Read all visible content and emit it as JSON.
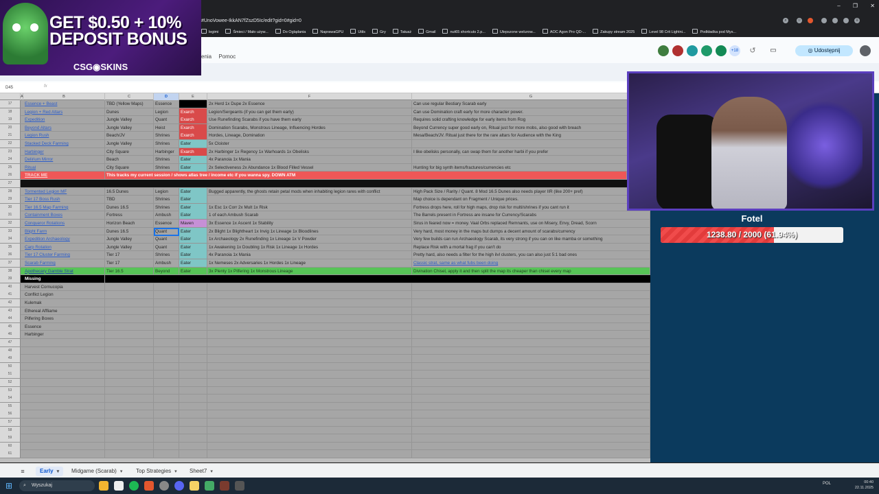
{
  "browser": {
    "url": "#UnoVowee-IkkAN7fZszD5Ic/edit?gid=0#gid=0",
    "bookmarks": [
      "legimi",
      "Śmieci / Mało używ...",
      "Do Oglądania",
      "NaprawaGPU",
      "Utils",
      "Gry",
      "Tatuaż",
      "Gmail",
      "nut65 shortcuts 2.p...",
      "Ulepszone welurow...",
      "AOC Agon Pro QD-...",
      "Zakupy stream 2025",
      "Level 98 Crit Lightni...",
      "Podkładka pod Mys..."
    ]
  },
  "sheets": {
    "menu": [
      "enia",
      "Pomoc"
    ],
    "extensions_count": "+18",
    "share_label": "Udostępnij",
    "namebox": "D45"
  },
  "ad": {
    "line1": "GET $0.50 + 10%",
    "line2": "DEPOSIT BONUS",
    "brand": "CSG◉SKINS"
  },
  "columns": [
    "A",
    "B",
    "C",
    "D",
    "E",
    "F",
    "G"
  ],
  "selected_column": "D",
  "rows": [
    {
      "n": "17",
      "b": "Essence + Beast",
      "c": "TBD (Yellow Maps)",
      "d": "Essence",
      "e": "",
      "ecls": "blackcell",
      "f": "2x Herd 1x Dupe 2x Essence",
      "g": "Can use regular Bestiary Scarab early"
    },
    {
      "n": "18",
      "b": "Legion + Red Altars",
      "c": "Dunes",
      "d": "Legion",
      "e": "Exarch",
      "ecls": "exarch",
      "f": "Legion/Sergeants (if you can get them early)",
      "g": "Can use Domination craft early for more character power."
    },
    {
      "n": "19",
      "b": "Expedition",
      "c": "Jungle Valley",
      "d": "Quant",
      "e": "Exarch",
      "ecls": "exarch",
      "f": "Use Runefinding Scarabs if you have them early",
      "g": "Requires solid crafting knowledge for early items from Rog"
    },
    {
      "n": "20",
      "b": "Beyond Altars",
      "c": "Jungle Valley",
      "d": "Heist",
      "e": "Exarch",
      "ecls": "exarch",
      "f": "Domination Scarabs, Monstrous Lineage, Influencing Hordes",
      "g": "Beyond Currency super good early on, Ritual just for more mobs, also good with breach"
    },
    {
      "n": "21",
      "b": "Legion Rush",
      "c": "Beach/JV",
      "d": "Shrines",
      "e": "Exarch",
      "ecls": "exarch",
      "f": "Hordes, Lineage, Domination",
      "g": "Mesa/Beach/JV. Ritual just there for the rare altars for Audience with the King"
    },
    {
      "n": "22",
      "b": "Stacked Deck Farming",
      "c": "Jungle Valley",
      "d": "Shrines",
      "e": "Eater",
      "ecls": "eater",
      "f": "5x Cloister",
      "g": ""
    },
    {
      "n": "23",
      "b": "Harbinger",
      "c": "City Square",
      "d": "Harbinger",
      "e": "Exarch",
      "ecls": "exarch",
      "f": "2x Harbinger 1x Regency 1x Warhoards 1x Obelisks",
      "g": "I like obelisks personally, can swap them for another harbi if you prefer"
    },
    {
      "n": "24",
      "b": "Delirium Mirror",
      "c": "Beach",
      "d": "Shrines",
      "e": "Eater",
      "ecls": "eater",
      "f": "4x Paranoia 1x Mania",
      "g": ""
    },
    {
      "n": "25",
      "b": "Ritual",
      "c": "City Square",
      "d": "Shrines",
      "e": "Eater",
      "ecls": "eater",
      "f": "2x Selectiveness 2x Abundance 1x Blood Filled Vessel",
      "g": "Hunting for big synth items/fractures/currencies etc"
    },
    {
      "n": "26",
      "type": "red",
      "b": "TRACK ME",
      "c": "This tracks my current session / shows atlas tree / income etc if you wanna spy. DOWN ATM"
    },
    {
      "n": "27",
      "type": "blank"
    },
    {
      "n": "28",
      "b": "Tormented Legion MF",
      "c": "16.5 Dunes",
      "d": "Legion",
      "e": "Eater",
      "ecls": "eater",
      "f": "Bugged apparently, the ghosts retain petal mods when inhabiting legion rares with conflict",
      "g": "High Pack Size / Rarity / Quant. 8 Mod 16.5 Dunes also needs player IIR (like 200+ pref)"
    },
    {
      "n": "29",
      "b": "Tier 17 Boss Rush",
      "c": "TBD",
      "d": "Shrines",
      "e": "Eater",
      "ecls": "eater",
      "f": "",
      "g": "Map choice is dependant on Fragment / Unique prices."
    },
    {
      "n": "30",
      "b": "Tier 16.5 Map Farming",
      "c": "Dunes 16.5",
      "d": "Shrines",
      "e": "Eater",
      "ecls": "eater",
      "f": "1x Esc 1x Corr 2x Mult 1x Risk",
      "g": "Fortress drops here, roll for high maps, drop risk for multi/shrines if you cant run it"
    },
    {
      "n": "31",
      "b": "Containment Boxes",
      "c": "Fortress",
      "d": "Ambush",
      "e": "Eater",
      "ecls": "eater",
      "f": "1 of each Ambush Scarab",
      "g": "The Barrels present in Fortress are insane for Currency/Scarabs"
    },
    {
      "n": "32",
      "b": "Conqueror Rotations",
      "c": "Horizon Beach",
      "d": "Essence",
      "e": "Maven",
      "ecls": "maven",
      "f": "3x Essence 1x Ascent 1x Stability",
      "g": "Sirus in feared now = money. Vaal Orbs replaced Remnants, use on Misery, Envy, Dread, Scorn"
    },
    {
      "n": "33",
      "b": "Blight Farm",
      "c": "Dunes 16.5",
      "d": "Quant",
      "e": "Eater",
      "ecls": "eater",
      "f": "2x Blight 1x Blightheart 1x Invig 1x Lineage 1x Bloodlines",
      "g": "Very hard, most money in the maps but dumps a decent amount of scarabs/currency"
    },
    {
      "n": "34",
      "b": "Expedition Archaeology",
      "c": "Jungle Valley",
      "d": "Quant",
      "e": "Eater",
      "ecls": "eater",
      "f": "1x Archaeology 2x Runefinding 1x Lineage 1x V Powder",
      "g": "Very few builds can run Archaeology Scarab, its very strong if you can on like mamba or something"
    },
    {
      "n": "35",
      "b": "Carp Rotation",
      "c": "Jungle Valley",
      "d": "Quant",
      "e": "Eater",
      "ecls": "eater",
      "f": "1x Awakening 1x Doubling 1x Risk 1x Lineage 1x Hordes",
      "g": "Replace Risk with a mortal frag if you can't do"
    },
    {
      "n": "36",
      "b": "Tier 17 Cluster Farming",
      "c": "Tier 17",
      "d": "Shrines",
      "e": "Eater",
      "ecls": "eater",
      "f": "4x Paranoia 1x Mania",
      "g": "Pretty hard, also needs a filter for the high ilvl clusters, you can also just 5:1 bad ones"
    },
    {
      "n": "37",
      "b": "Scarab Farming",
      "c": "Tier 17",
      "d": "Ambush",
      "e": "Eater",
      "ecls": "eater",
      "f": "1x Nemeses 2x Adversaries 1x Hordes 1x Lineage",
      "g": "Classic strat, same as what fubs been doing",
      "glink": true
    },
    {
      "n": "38",
      "type": "green",
      "b": "Apothecary Gamble Strat",
      "c": "Tier 16.5",
      "d": "Beyond",
      "e": "Eater",
      "f": "3x Plenty 1x Pilfering 1x Monstrous Lineage",
      "g": "Divination Chisel, apply it and then split the map its cheaper than chisel every map"
    },
    {
      "n": "39",
      "type": "black",
      "b": "Missing"
    },
    {
      "n": "40",
      "b": "Harvest Cornucopia",
      "bplain": true
    },
    {
      "n": "41",
      "b": "Conflict Legion",
      "bplain": true
    },
    {
      "n": "42",
      "b": "Kulemak",
      "bplain": true
    },
    {
      "n": "43",
      "b": "Ethereal Affliame",
      "bplain": true
    },
    {
      "n": "44",
      "b": "Pilfering Boxes",
      "bplain": true
    },
    {
      "n": "45",
      "b": "Essence",
      "bplain": true
    },
    {
      "n": "46",
      "b": "Harbinger",
      "bplain": true
    },
    {
      "n": "47"
    },
    {
      "n": "48"
    },
    {
      "n": "49"
    },
    {
      "n": "50"
    },
    {
      "n": "51"
    },
    {
      "n": "52"
    },
    {
      "n": "53"
    },
    {
      "n": "54"
    },
    {
      "n": "55"
    },
    {
      "n": "56"
    },
    {
      "n": "57"
    },
    {
      "n": "58"
    },
    {
      "n": "59"
    },
    {
      "n": "60"
    },
    {
      "n": "61"
    }
  ],
  "stream": {
    "goal_title": "Fotel",
    "goal_text": "1238.80 / 2000 (61.94%)",
    "goal_progress": 0.6194
  },
  "tabs": [
    "Early",
    "Midgame (Scarab)",
    "Top Strategies",
    "Sheet7"
  ],
  "active_tab": "Early",
  "taskbar": {
    "search_placeholder": "Wyszukaj",
    "language": "POL",
    "time": "00:40",
    "date": "22.11.2025"
  }
}
